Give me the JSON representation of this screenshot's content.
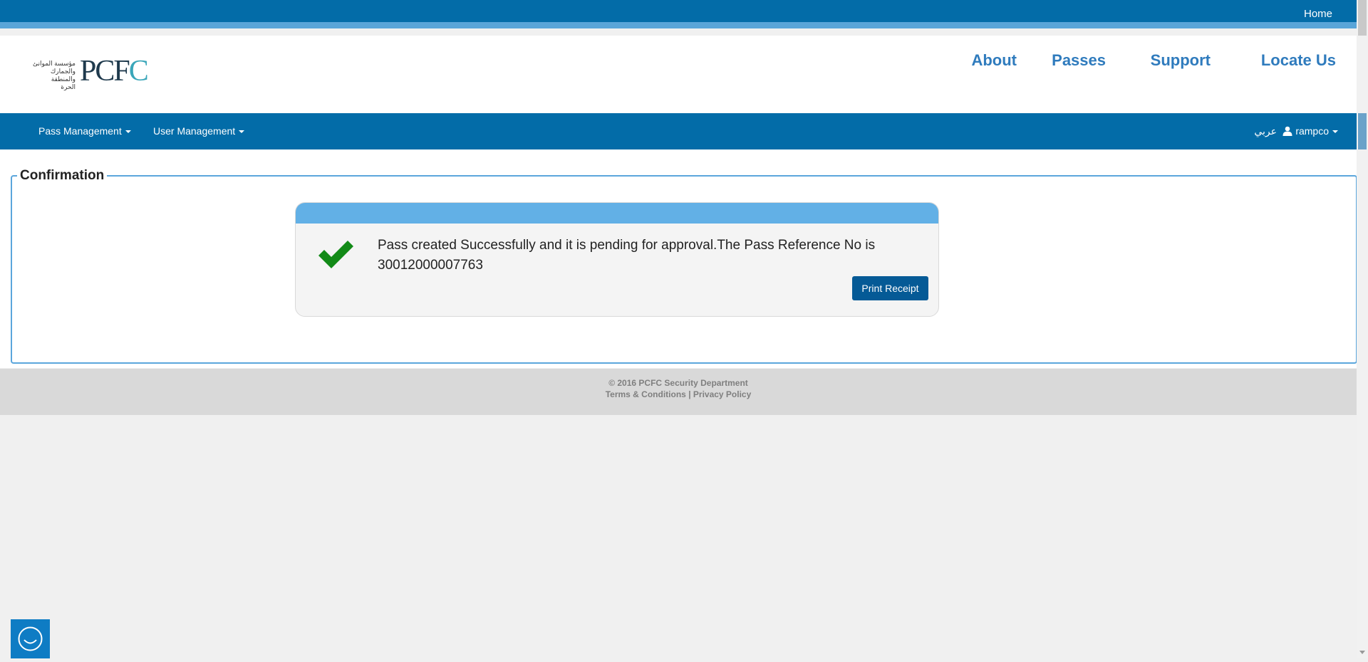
{
  "topbar": {
    "home_label": "Home"
  },
  "logo": {
    "arabic_line1": "مؤسسة الموانئ",
    "arabic_line2": "والجمارك والمنطقة",
    "arabic_line3": "الحرة",
    "text_part1": "PCF",
    "text_part2": "C"
  },
  "main_nav": [
    {
      "label": "About"
    },
    {
      "label": "Passes"
    },
    {
      "label": "Support"
    },
    {
      "label": "Locate Us"
    }
  ],
  "navbar": {
    "pass_management": "Pass Management",
    "user_management": "User Management",
    "language": "عربي",
    "username": "rampco"
  },
  "confirmation": {
    "legend": "Confirmation",
    "message": "Pass created Successfully and it is pending for approval.The Pass Reference No is 30012000007763",
    "print_button": "Print Receipt"
  },
  "footer": {
    "copyright": "© 2016 PCFC Security Department",
    "terms": "Terms & Conditions",
    "separator": "|",
    "privacy": "Privacy Policy"
  },
  "colors": {
    "primary_blue": "#036ca8",
    "light_blue": "#62b0e6",
    "link_blue": "#2f7bbd",
    "success_green": "#128a17",
    "button_blue": "#055a96"
  },
  "icons": [
    "user-icon",
    "caret-down-icon",
    "checkmark-icon",
    "chat-icon"
  ]
}
